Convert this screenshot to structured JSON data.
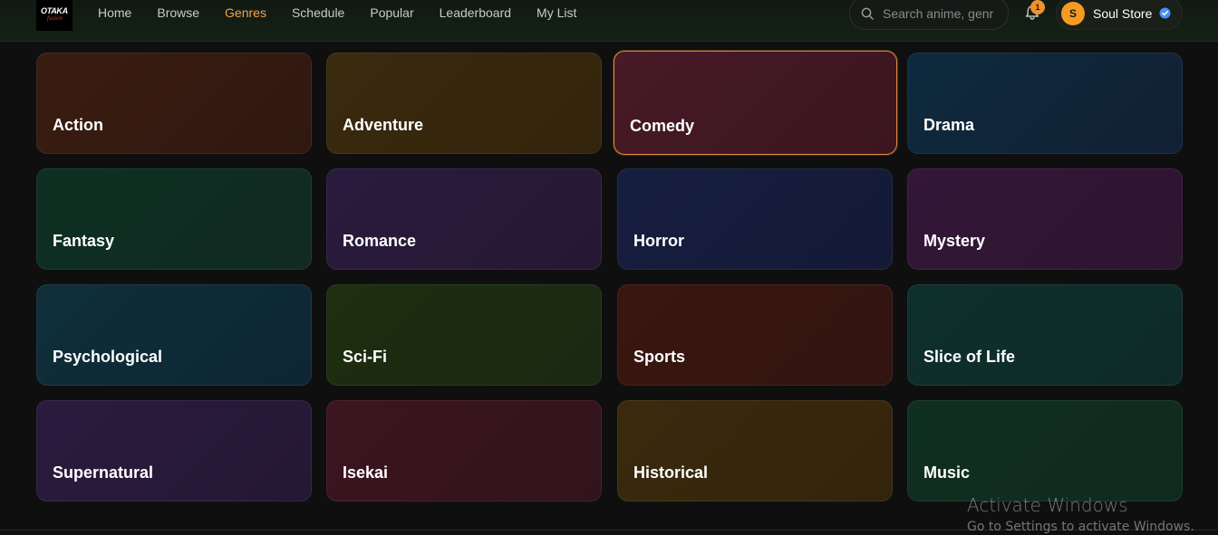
{
  "logo": {
    "line1": "OTAKA",
    "line2": "fusion"
  },
  "nav": {
    "items": [
      {
        "label": "Home",
        "active": false
      },
      {
        "label": "Browse",
        "active": false
      },
      {
        "label": "Genres",
        "active": true
      },
      {
        "label": "Schedule",
        "active": false
      },
      {
        "label": "Popular",
        "active": false
      },
      {
        "label": "Leaderboard",
        "active": false
      },
      {
        "label": "My List",
        "active": false
      }
    ]
  },
  "search": {
    "placeholder": "Search anime, genr"
  },
  "notifications": {
    "count": "1"
  },
  "user": {
    "initial": "S",
    "name": "Soul Store"
  },
  "genres": [
    {
      "label": "Action",
      "from": "#3a1d10",
      "to": "#301710"
    },
    {
      "label": "Adventure",
      "from": "#3a2a0e",
      "to": "#33240c"
    },
    {
      "label": "Comedy",
      "from": "#471a26",
      "to": "#3b1520",
      "highlighted": true
    },
    {
      "label": "Drama",
      "from": "#0e2a3e",
      "to": "#112034"
    },
    {
      "label": "Fantasy",
      "from": "#0d3022",
      "to": "#112a22"
    },
    {
      "label": "Romance",
      "from": "#2a1a3e",
      "to": "#261834"
    },
    {
      "label": "Horror",
      "from": "#161e40",
      "to": "#141a36"
    },
    {
      "label": "Mystery",
      "from": "#331638",
      "to": "#2e1530"
    },
    {
      "label": "Psychological",
      "from": "#0e2f3a",
      "to": "#0e2634"
    },
    {
      "label": "Sci-Fi",
      "from": "#1e2e0f",
      "to": "#1a2912"
    },
    {
      "label": "Sports",
      "from": "#3a1610",
      "to": "#321410"
    },
    {
      "label": "Slice of Life",
      "from": "#0e302c",
      "to": "#0e2a28"
    },
    {
      "label": "Supernatural",
      "from": "#2b1a3f",
      "to": "#241834"
    },
    {
      "label": "Isekai",
      "from": "#3c1520",
      "to": "#32131c"
    },
    {
      "label": "Historical",
      "from": "#3a2a0d",
      "to": "#33240c"
    },
    {
      "label": "Music",
      "from": "#0f3020",
      "to": "#112a1e"
    }
  ],
  "watermark": {
    "line1": "Activate Windows",
    "line2": "Go to Settings to activate Windows."
  }
}
